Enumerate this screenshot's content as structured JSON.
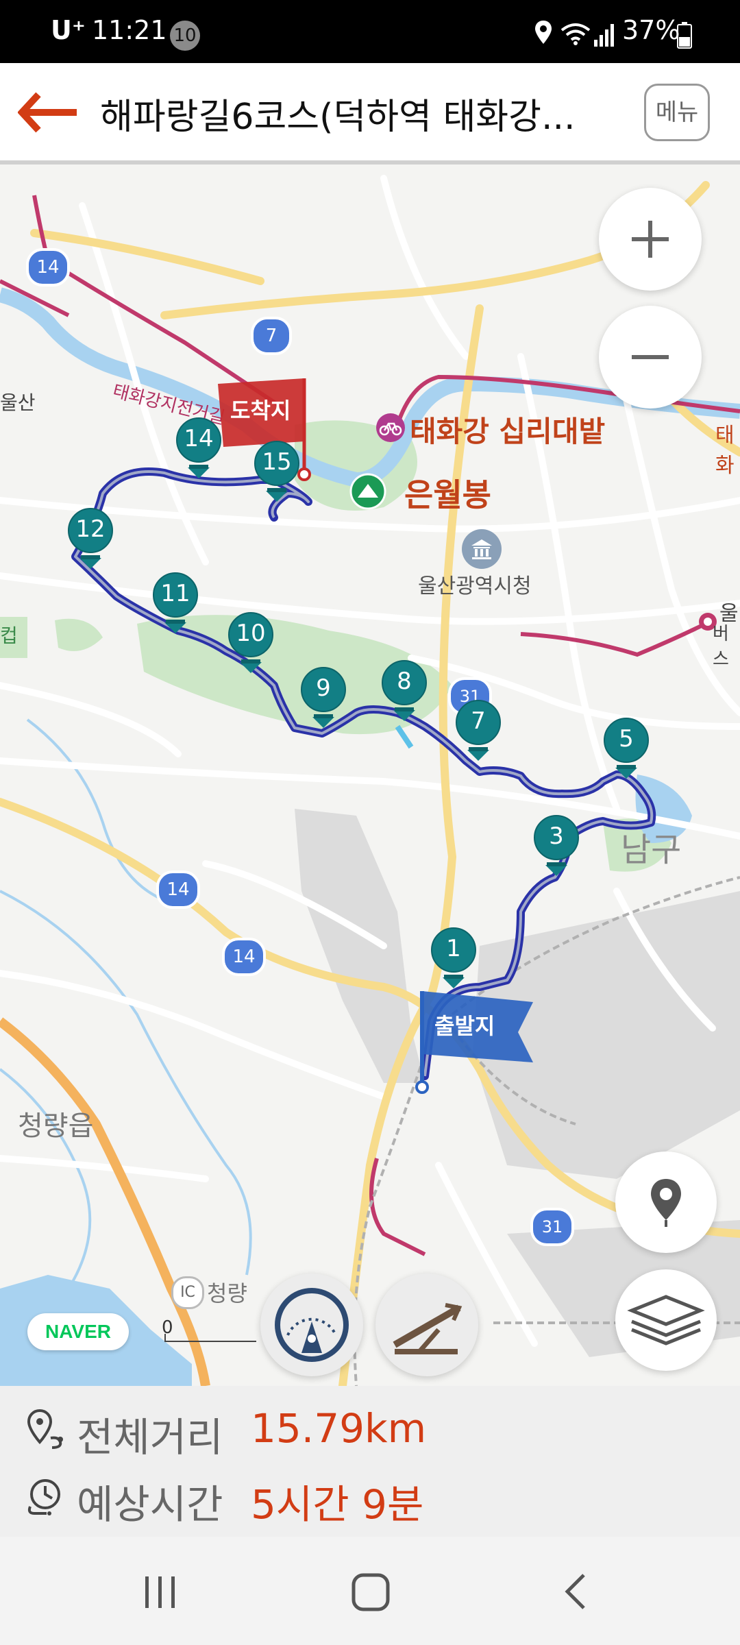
{
  "status_bar": {
    "carrier": "U⁺",
    "time": "11:21",
    "notification_count": "10",
    "battery": "37%"
  },
  "header": {
    "title": "해파랑길6코스(덕하역  태화강...",
    "menu_label": "메뉴"
  },
  "map": {
    "places": {
      "ulsan_west": "울산",
      "taehwagang_sign": "태화강지전거길",
      "sipridaebat": "태화강 십리대밭",
      "eunwolbong": "은월봉",
      "city_hall": "울산광역시청",
      "east_edge": "태화",
      "cup_edge": "컵",
      "east_edge2": "울",
      "east_edge3": "버스",
      "nam_gu": "남구",
      "cheongnyang_eup": "청량읍",
      "cheongnyang_ic": "청량",
      "ic_badge": "IC"
    },
    "route_shields": [
      "14",
      "7",
      "31",
      "14",
      "14",
      "31"
    ],
    "flags": {
      "start": "출발지",
      "end": "도착지"
    },
    "waypoints": [
      "1",
      "3",
      "5",
      "7",
      "8",
      "9",
      "10",
      "11",
      "12",
      "14",
      "15"
    ],
    "scale_label": "0",
    "logo": "NAVER"
  },
  "info": {
    "distance_label": "전체거리",
    "distance_value": "15.79km",
    "time_label": "예상시간",
    "time_value": "5시간 9분"
  },
  "colors": {
    "accent": "#d23c14",
    "route": "#2a32a8",
    "marker": "#127f85",
    "river": "#a8d2f0",
    "park": "#cde7c7"
  }
}
